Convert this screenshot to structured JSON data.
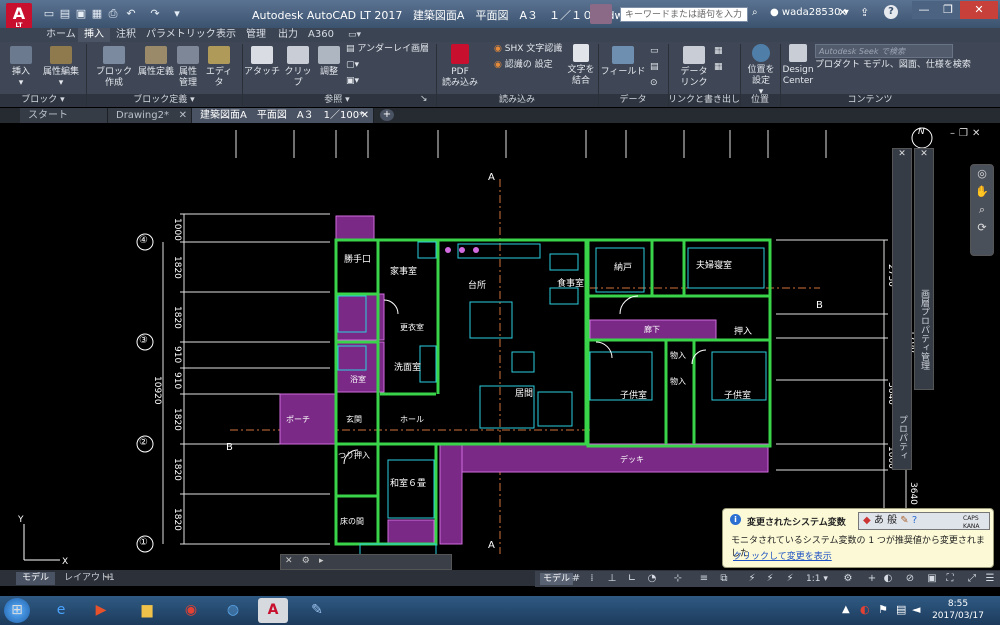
{
  "title_bar": {
    "app_title": "Autodesk AutoCAD LT 2017",
    "file_title": "建築図面A　平面図　A３　１／１００.dwg",
    "search_placeholder": "キーワードまたは語句を入力",
    "user": "wada28530",
    "logo_text": "A",
    "logo_sub": "LT"
  },
  "ribbon_tabs": [
    "ホーム",
    "挿入",
    "注釈",
    "パラメトリック",
    "表示",
    "管理",
    "出力",
    "A360"
  ],
  "active_ribbon_tab": "挿入",
  "ribbon": {
    "block": {
      "insert": "挿入",
      "edit_attr": "属性編集",
      "group": "ブロック"
    },
    "block_def": {
      "create": "ブロック\n作成",
      "define_attr": "属性定義",
      "manage_attr": "属性\n管理",
      "editor": "エディタ",
      "group": "ブロック定義"
    },
    "reference": {
      "attach": "アタッチ",
      "clip": "クリップ",
      "adjust": "調整",
      "underlay": "アンダーレイ画層",
      "group": "参照"
    },
    "import": {
      "pdf": "PDF\n読み込み",
      "shx": "SHX 文字認識",
      "recog": "認識の 設定",
      "combine": "文字を\n結合",
      "group": "読み込み"
    },
    "data": {
      "field": "フィールド",
      "group": "データ"
    },
    "link": {
      "data_link": "データ\nリンク",
      "group": "リンクと書き出し"
    },
    "location": {
      "set": "位置を\n設定",
      "group": "位置"
    },
    "content": {
      "design_center": "Design\nCenter",
      "seek_placeholder": "Autodesk Seek で検索",
      "seek_desc": "プロダクト モデル、図面、仕様を検索",
      "group": "コンテンツ"
    }
  },
  "doc_tabs": [
    "スタート",
    "Drawing2*",
    "建築図面A　平面図　A３　1／100*"
  ],
  "active_doc_tab": "建築図面A　平面図　A３　1／100*",
  "drawing": {
    "rooms": [
      "勝手口",
      "家事室",
      "台所",
      "食事室",
      "納戸",
      "夫婦寝室",
      "更衣室",
      "洗面室",
      "浴室",
      "居間",
      "廊下",
      "押入",
      "物入",
      "物入",
      "子供室",
      "子供室",
      "ポーチ",
      "玄関",
      "ホール",
      "つり押入",
      "和室６畳",
      "床の間",
      "デッキ"
    ],
    "axis_labels": [
      "④",
      "③",
      "②",
      "①"
    ],
    "dims_left": [
      "1000",
      "1820",
      "1820",
      "910",
      "910",
      "1820",
      "1820",
      "1820"
    ],
    "dim_total": "10920",
    "dims_right": [
      "2730",
      "1760",
      "3640",
      "1000",
      "3640"
    ],
    "section_marks": [
      "A",
      "A",
      "B",
      "B"
    ],
    "north": "N"
  },
  "palettes": {
    "properties": "プロパティ",
    "layer": "画層プロパティ管理"
  },
  "layout_tabs": [
    "モデル",
    "レイアウト1"
  ],
  "active_layout_tab": "モデル",
  "status": {
    "model": "モデル",
    "scale": "1:1"
  },
  "notification": {
    "title": "変更されたシステム変数",
    "body": "モニタされているシステム変数の 1 つが推奨値から変更されました",
    "link": "クリックして変更を表示"
  },
  "ime": {
    "mode": "あ 般",
    "caps": "CAPS",
    "kana": "KANA"
  },
  "clock": {
    "time": "8:55",
    "date": "2017/03/17"
  }
}
